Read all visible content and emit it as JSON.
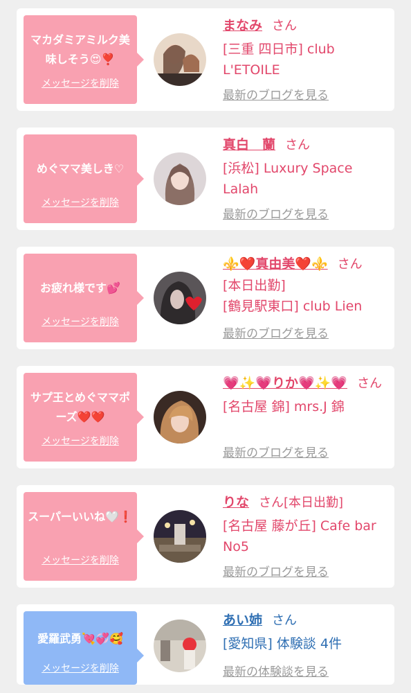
{
  "delete_label": "メッセージを削除",
  "blog_label": "最新のブログを見る",
  "review_label": "最新の体験談を見る",
  "colors": {
    "pink_bubble": "#f9a1b1",
    "blue_bubble": "#8fb8f6",
    "name_pink": "#e2476b",
    "name_blue": "#2f6fb3"
  },
  "cards": [
    {
      "message": "マカダミアミルク美味しそう😍❣️",
      "name": "まなみ",
      "san": "さん",
      "store": "[三重 四日市] club L'ETOILE"
    },
    {
      "message": "めぐママ美しき♡",
      "name": "真白　蘭",
      "san": "さん",
      "store": "[浜松] Luxury Space Lalah"
    },
    {
      "message": "お疲れ様です💕",
      "name": "⚜️❤️真由美❤️⚜️",
      "san": "さん",
      "store_line1": "[本日出勤]",
      "store_line2": "[鶴見駅東口] club Lien"
    },
    {
      "message": "サプ王とめぐママポーズ❤️❤️",
      "name": "💗✨💗りか💗✨💗",
      "san": "さん",
      "store": "[名古屋 錦] mrs.J 錦"
    },
    {
      "message": "スーパーいいね🤍❗️",
      "name": "りな",
      "san": "さん[本日出勤]",
      "store": "[名古屋 藤が丘] Cafe bar No5"
    },
    {
      "message": "愛羅武勇💘💞🥰",
      "name": "あい姉",
      "san": "さん",
      "store": "[愛知県] 体験談 4件"
    }
  ]
}
